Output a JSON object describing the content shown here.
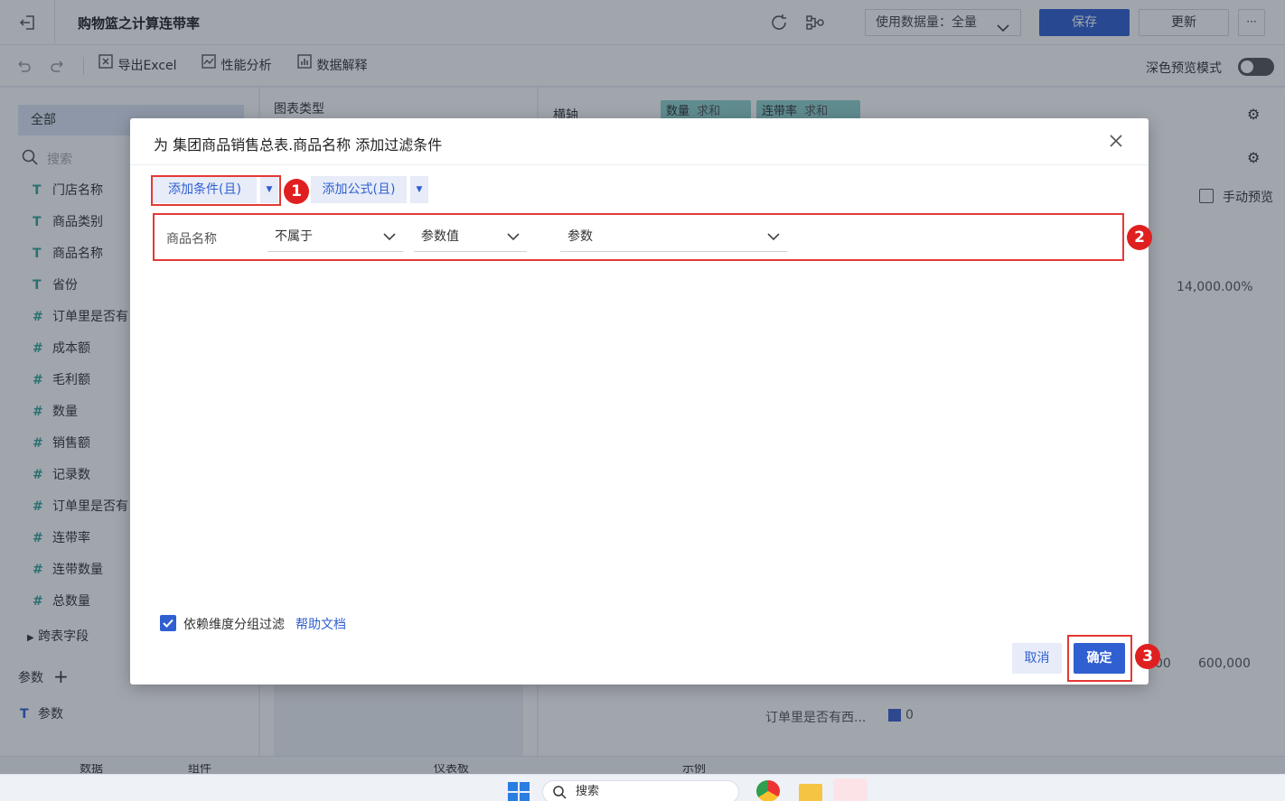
{
  "topbar": {
    "title": "购物篮之计算连带率",
    "data_usage_label": "使用数据量：全量",
    "save_label": "保存",
    "update_label": "更新",
    "more_label": "···"
  },
  "toolbar": {
    "export_label": "导出Excel",
    "perf_label": "性能分析",
    "explain_label": "数据解释",
    "dark_mode_label": "深色预览模式"
  },
  "left": {
    "scope_label": "全部",
    "search_placeholder": "搜索",
    "fields": [
      {
        "icon": "T",
        "label": "门店名称"
      },
      {
        "icon": "T",
        "label": "商品类别"
      },
      {
        "icon": "T",
        "label": "商品名称"
      },
      {
        "icon": "T",
        "label": "省份"
      },
      {
        "icon": "#",
        "label": "订单里是否有"
      },
      {
        "icon": "#",
        "label": "成本额"
      },
      {
        "icon": "#",
        "label": "毛利额"
      },
      {
        "icon": "#",
        "label": "数量"
      },
      {
        "icon": "#",
        "label": "销售额"
      },
      {
        "icon": "#",
        "label": "记录数"
      },
      {
        "icon": "#",
        "label": "订单里是否有"
      },
      {
        "icon": "#",
        "label": "连带率"
      },
      {
        "icon": "#",
        "label": "连带数量"
      },
      {
        "icon": "#",
        "label": "总数量"
      }
    ],
    "cross_table_label": "跨表字段",
    "params_label": "参数",
    "param_item_label": "参数"
  },
  "middle": {
    "chart_type_label": "图表类型"
  },
  "right": {
    "x_axis_label": "横轴",
    "pill1_label": "数量",
    "pill1_agg": "求和",
    "pill2_label": "连带率",
    "pill2_agg": "求和",
    "manual_preview_label": "手动预览",
    "axis_top_value": "14,000.00%",
    "axis_bottom_value1": "00",
    "axis_bottom_value2": "600,000",
    "legend_label": "订单里是否有西...",
    "legend_value": "0"
  },
  "bottom": {
    "tab_data": "数据",
    "tab_component": "组件",
    "tab_dashboard": "仪表板",
    "tab_example": "示例"
  },
  "taskbar": {
    "search_label": "搜索"
  },
  "dialog": {
    "title": "为 集团商品销售总表.商品名称 添加过滤条件",
    "add_condition_label": "添加条件(且)",
    "add_formula_label": "添加公式(且)",
    "condition": {
      "field": "商品名称",
      "operator": "不属于",
      "value_type": "参数值",
      "param": "参数"
    },
    "checkbox_label": "依赖维度分组过滤",
    "help_label": "帮助文档",
    "cancel_label": "取消",
    "ok_label": "确定",
    "badges": [
      "1",
      "2",
      "3"
    ]
  },
  "colors": {
    "primary": "#2f5fd1",
    "annotation_red": "#e53935",
    "field_icon": "#35a39a",
    "pill_teal": "#8fd3cd"
  }
}
